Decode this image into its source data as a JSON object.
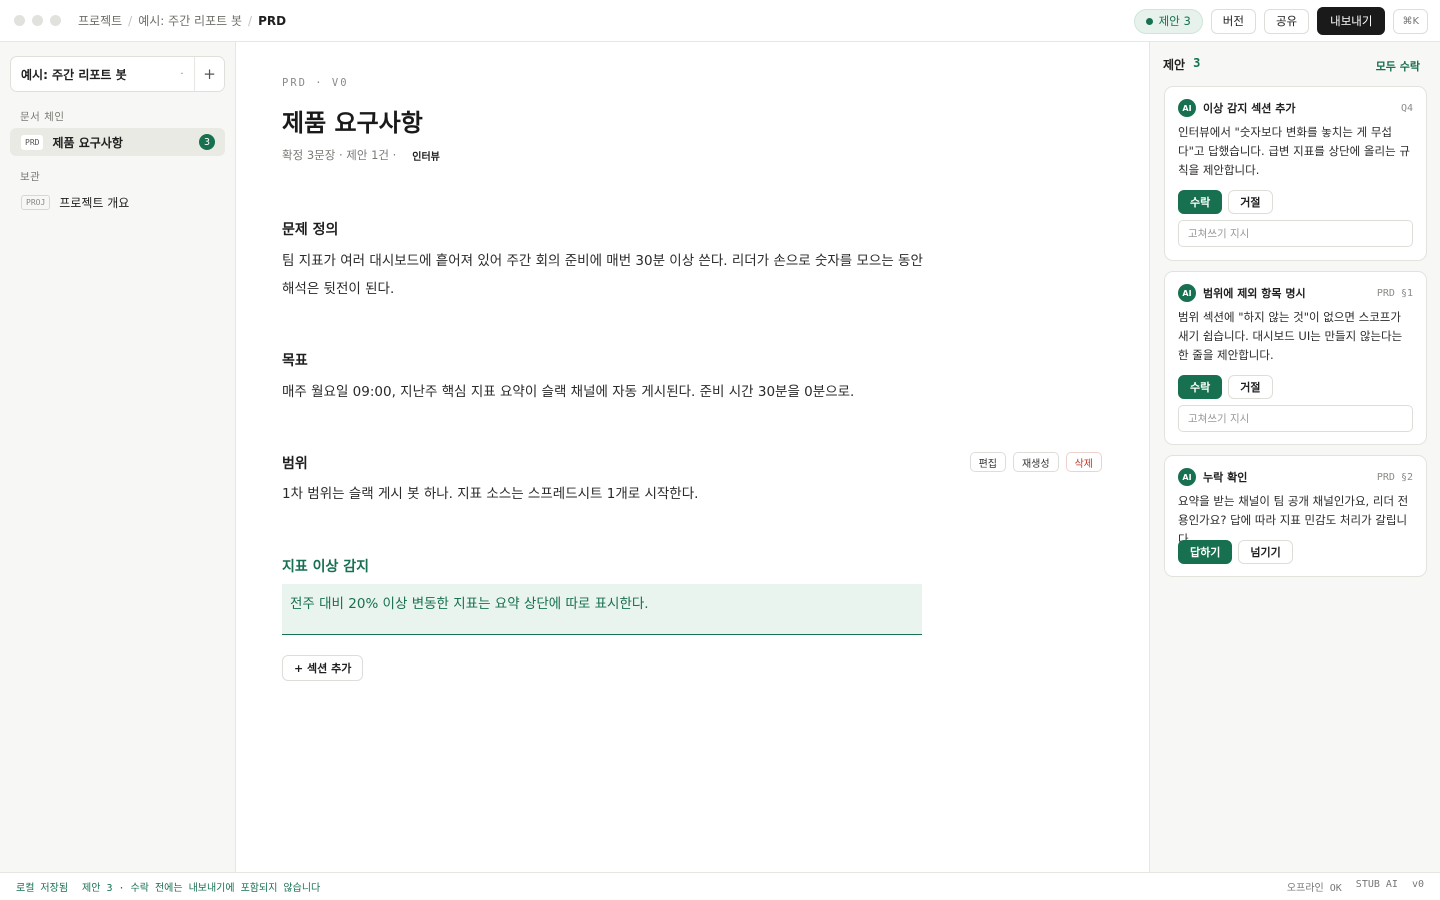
{
  "breadcrumb": [
    "프로젝트",
    "예시: 주간 리포트 봇",
    "PRD"
  ],
  "topbar": {
    "suggestions_pill": "제안 3",
    "version_label": "버전",
    "share_label": "공유",
    "export_label": "내보내기",
    "shortcut_label": "⌘K"
  },
  "sidebar": {
    "project_name": "예시: 주간 리포트 봇",
    "chev": "·",
    "add": "+",
    "section_chain": "문서 체인",
    "section_archive": "보관",
    "chain_items": [
      {
        "tag": "PRD",
        "label": "제품 요구사항",
        "badge": "3"
      }
    ],
    "archive_items": [
      {
        "tag": "PROJ",
        "label": "프로젝트 개요"
      }
    ]
  },
  "doc": {
    "kicker": "PRD · V0",
    "title": "제품 요구사항",
    "meta": "확정 3문장 · 제안 1건 ·",
    "meta_chip": "인터뷰",
    "sections": [
      {
        "heading": "문제 정의",
        "body": "팀 지표가 여러 대시보드에 흩어져 있어 주간 회의 준비에 매번 30분 이상 쓴다. 리더가 손으로 숫자를 모으는 동안 해석은 뒷전이 된다."
      },
      {
        "heading": "목표",
        "body": "매주 월요일 09:00, 지난주 핵심 지표 요약이 슬랙 채널에 자동 게시된다. 준비 시간 30분을 0분으로."
      },
      {
        "heading": "범위",
        "body": "1차 범위는 슬랙 게시 봇 하나. 지표 소스는 스프레드시트 1개로 시작한다."
      },
      {
        "heading": "지표 이상 감지",
        "body": "전주 대비 20% 이상 변동한 지표는 요약 상단에 따로 표시한다."
      }
    ],
    "tools": {
      "edit": "편집",
      "regen": "재생성",
      "delete": "삭제"
    },
    "add_section": "+ 섹션 추가"
  },
  "panel": {
    "title": "제안",
    "count": "3",
    "accept_all": "모두 수락",
    "cards": [
      {
        "ai": "AI",
        "title": "이상 감지 섹션 추가",
        "ref": "Q4",
        "body": "인터뷰에서 \"숫자보다 변화를 놓치는 게 무섭다\"고 답했습니다. 급변 지표를 상단에 올리는 규칙을 제안합니다.",
        "primary": "수락",
        "secondary": "거절",
        "rewrite_placeholder": "고쳐쓰기 지시"
      },
      {
        "ai": "AI",
        "title": "범위에 제외 항목 명시",
        "ref": "PRD §1",
        "body": "범위 섹션에 \"하지 않는 것\"이 없으면 스코프가 새기 쉽습니다. 대시보드 UI는 만들지 않는다는 한 줄을 제안합니다.",
        "primary": "수락",
        "secondary": "거절",
        "rewrite_placeholder": "고쳐쓰기 지시"
      },
      {
        "ai": "AI",
        "title": "누락 확인",
        "ref": "PRD §2",
        "body": "요약을 받는 채널이 팀 공개 채널인가요, 리더 전용인가요? 답에 따라 지표 민감도 처리가 갈립니다.",
        "primary": "답하기",
        "secondary": "넘기기"
      }
    ]
  },
  "status": {
    "saved": "로컬 저장됨",
    "note": "제안 3 · 수락 전에는 내보내기에 포함되지 않습니다",
    "offline": "오프라인 OK",
    "ai": "STUB AI",
    "version": "v0"
  },
  "colors": {
    "accent": "#17704f",
    "accent_bg": "#e9f4ef",
    "danger": "#c0392b"
  }
}
